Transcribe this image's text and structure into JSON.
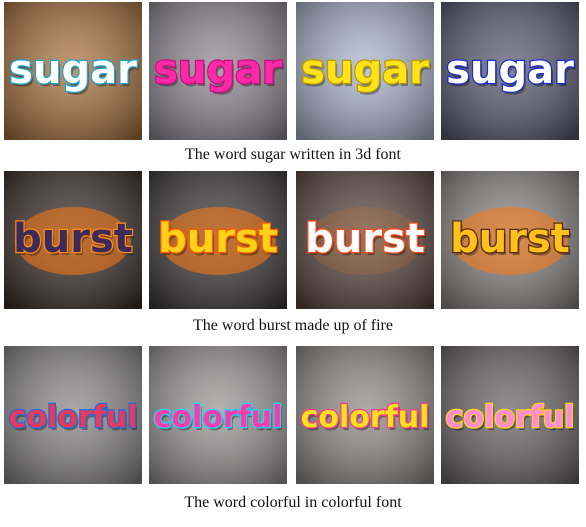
{
  "rows": [
    {
      "caption": "The word sugar written in 3d font",
      "tiles": [
        {
          "word": "sugar",
          "bg": "#a8743f",
          "fill": "#ffffff",
          "stroke": "#1ea3d8"
        },
        {
          "word": "sugar",
          "bg": "#8f8a94",
          "fill": "#ff2aa8",
          "stroke": "#c4127c"
        },
        {
          "word": "sugar",
          "bg": "#aab4cc",
          "fill": "#ffe21a",
          "stroke": "#b79a00"
        },
        {
          "word": "sugar",
          "bg": "#5a5a70",
          "fill": "#ffffff",
          "stroke": "#1a2bd6"
        }
      ]
    },
    {
      "caption": "The word burst made up of fire",
      "tiles": [
        {
          "word": "burst",
          "bg": "#3a2f2a",
          "fill": "#3b2a5a",
          "stroke": "#ff8a1a"
        },
        {
          "word": "burst",
          "bg": "#3d3a3a",
          "fill": "#ffd21a",
          "stroke": "#ff5a00"
        },
        {
          "word": "burst",
          "bg": "#5a4740",
          "fill": "#ffffff",
          "stroke": "#ff4a1a"
        },
        {
          "word": "burst",
          "bg": "#8a8684",
          "fill": "#ffc21a",
          "stroke": "#5a2a0a"
        }
      ]
    },
    {
      "caption": "The word colorful in colorful font",
      "tiles": [
        {
          "word": "colorful",
          "bg": "#8a8888",
          "fill": "#e83a5a",
          "stroke": "#2a6ad8"
        },
        {
          "word": "colorful",
          "bg": "#9a9796",
          "fill": "#ff3aa8",
          "stroke": "#1ad8ff"
        },
        {
          "word": "colorful",
          "bg": "#8f8c8a",
          "fill": "#ffe21a",
          "stroke": "#ff3a8a"
        },
        {
          "word": "colorful",
          "bg": "#6a6668",
          "fill": "#ff8ad8",
          "stroke": "#ffd21a"
        }
      ]
    }
  ]
}
